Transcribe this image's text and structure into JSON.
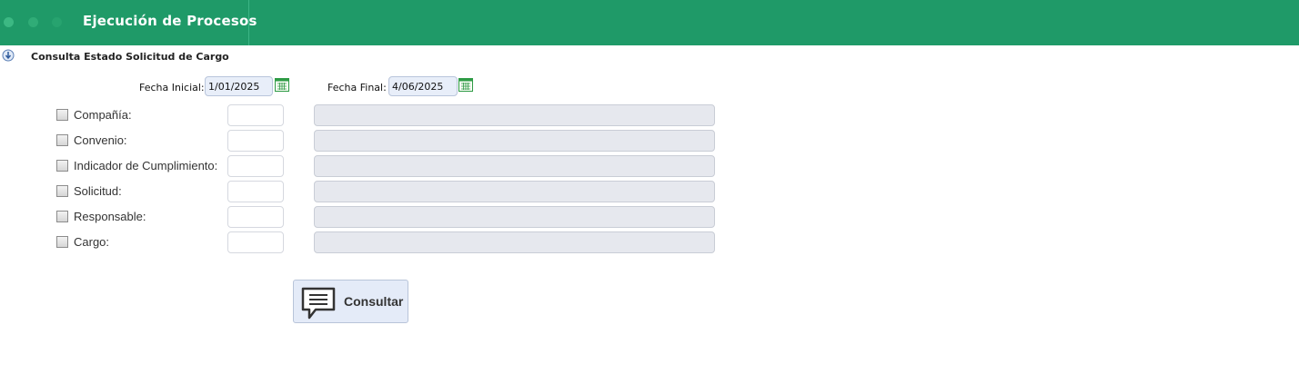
{
  "header": {
    "title": "Ejecución de Procesos"
  },
  "page": {
    "title": "Consulta Estado Solicitud de Cargo"
  },
  "dates": {
    "start_label": "Fecha Inicial:",
    "start_value": "1/01/2025",
    "end_label": "Fecha Final:",
    "end_value": "4/06/2025"
  },
  "filters": [
    {
      "label": "Compañía:",
      "checked": false,
      "code": "",
      "description": ""
    },
    {
      "label": "Convenio:",
      "checked": false,
      "code": "",
      "description": ""
    },
    {
      "label": "Indicador de Cumplimiento:",
      "checked": false,
      "code": "",
      "description": ""
    },
    {
      "label": "Solicitud:",
      "checked": false,
      "code": "",
      "description": ""
    },
    {
      "label": "Responsable:",
      "checked": false,
      "code": "",
      "description": ""
    },
    {
      "label": "Cargo:",
      "checked": false,
      "code": "",
      "description": ""
    }
  ],
  "actions": {
    "consult_label": "Consultar",
    "consult_icon": "speech-bubble-icon"
  },
  "colors": {
    "header_bg": "#1f9a68",
    "button_bg": "#e4ebf8",
    "date_input_bg": "#e8eef9",
    "calendar_green": "#2e9b45"
  }
}
